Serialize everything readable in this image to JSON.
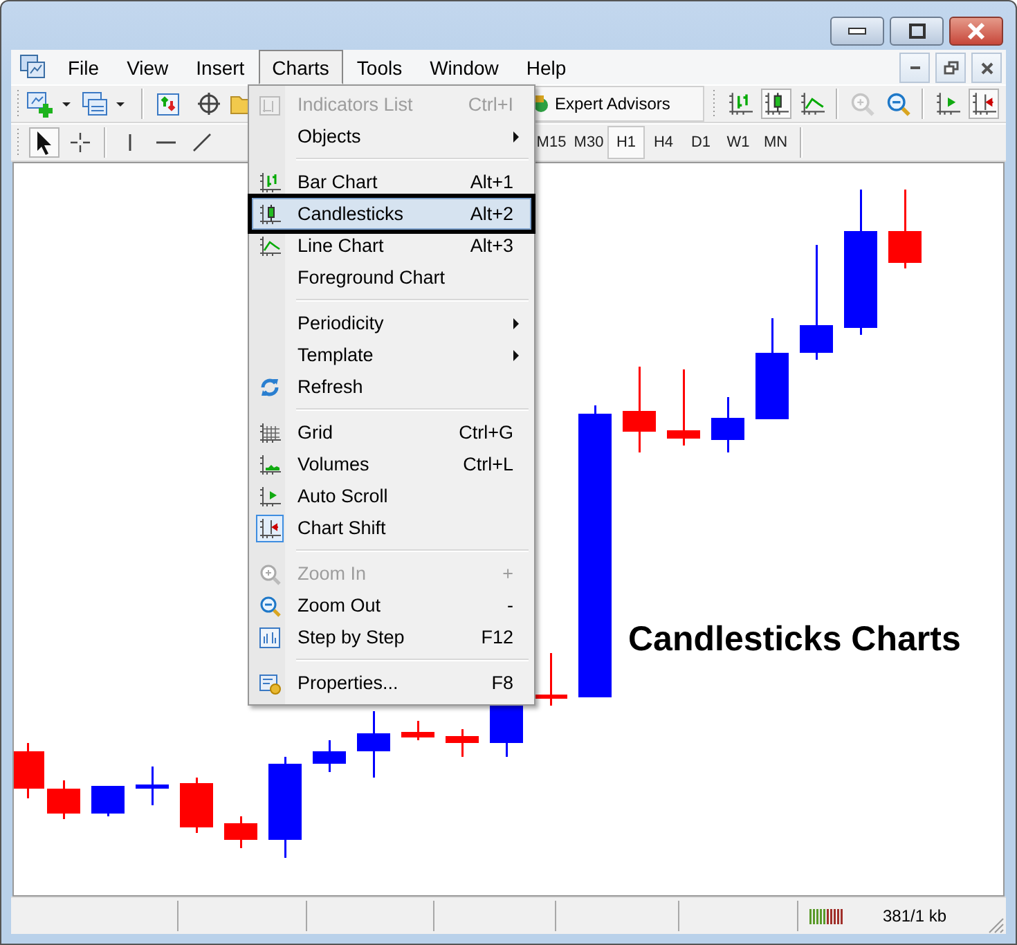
{
  "menu_bar": {
    "items": [
      {
        "label": "File",
        "selected": false
      },
      {
        "label": "View",
        "selected": false
      },
      {
        "label": "Insert",
        "selected": false
      },
      {
        "label": "Charts",
        "selected": true
      },
      {
        "label": "Tools",
        "selected": false
      },
      {
        "label": "Window",
        "selected": false
      },
      {
        "label": "Help",
        "selected": false
      }
    ]
  },
  "toolbar": {
    "expert_advisors": "Expert Advisors",
    "chart_type_buttons": [
      {
        "selected": false
      },
      {
        "selected": true
      },
      {
        "selected": false
      }
    ],
    "zoom_in_disabled": true,
    "chart_shift_on": true
  },
  "drawing_toolbar": {
    "tools": [
      {
        "selected": true
      },
      {
        "selected": false
      }
    ],
    "timeframes": [
      {
        "label": "M15",
        "selected": false
      },
      {
        "label": "M30",
        "selected": false
      },
      {
        "label": "H1",
        "selected": true
      },
      {
        "label": "H4",
        "selected": false
      },
      {
        "label": "D1",
        "selected": false
      },
      {
        "label": "W1",
        "selected": false
      },
      {
        "label": "MN",
        "selected": false
      }
    ]
  },
  "charts_menu": {
    "items": [
      {
        "kind": "item",
        "label": "Indicators List",
        "shortcut": "Ctrl+I",
        "disabled": true,
        "selected": false,
        "checked": false,
        "submenu": false
      },
      {
        "kind": "item",
        "label": "Objects",
        "disabled": false,
        "selected": false,
        "checked": false,
        "submenu": true
      },
      {
        "kind": "separator"
      },
      {
        "kind": "item",
        "label": "Bar Chart",
        "shortcut": "Alt+1",
        "disabled": false,
        "selected": false,
        "checked": false,
        "submenu": false
      },
      {
        "kind": "item",
        "label": "Candlesticks",
        "shortcut": "Alt+2",
        "disabled": false,
        "selected": true,
        "checked": false,
        "submenu": false
      },
      {
        "kind": "item",
        "label": "Line Chart",
        "shortcut": "Alt+3",
        "disabled": false,
        "selected": false,
        "checked": false,
        "submenu": false
      },
      {
        "kind": "item",
        "label": "Foreground Chart",
        "disabled": false,
        "selected": false,
        "checked": false,
        "submenu": false
      },
      {
        "kind": "separator"
      },
      {
        "kind": "item",
        "label": "Periodicity",
        "disabled": false,
        "selected": false,
        "checked": false,
        "submenu": true
      },
      {
        "kind": "item",
        "label": "Template",
        "disabled": false,
        "selected": false,
        "checked": false,
        "submenu": true
      },
      {
        "kind": "item",
        "label": "Refresh",
        "disabled": false,
        "selected": false,
        "checked": false,
        "submenu": false
      },
      {
        "kind": "separator"
      },
      {
        "kind": "item",
        "label": "Grid",
        "shortcut": "Ctrl+G",
        "disabled": false,
        "selected": false,
        "checked": false,
        "submenu": false
      },
      {
        "kind": "item",
        "label": "Volumes",
        "shortcut": "Ctrl+L",
        "disabled": false,
        "selected": false,
        "checked": false,
        "submenu": false
      },
      {
        "kind": "item",
        "label": "Auto Scroll",
        "disabled": false,
        "selected": false,
        "checked": false,
        "submenu": false
      },
      {
        "kind": "item",
        "label": "Chart Shift",
        "disabled": false,
        "selected": false,
        "checked": true,
        "submenu": false
      },
      {
        "kind": "separator"
      },
      {
        "kind": "item",
        "label": "Zoom In",
        "shortcut": "+",
        "disabled": true,
        "selected": false,
        "checked": false,
        "submenu": false
      },
      {
        "kind": "item",
        "label": "Zoom Out",
        "shortcut": "-",
        "disabled": false,
        "selected": false,
        "checked": false,
        "submenu": false
      },
      {
        "kind": "item",
        "label": "Step by Step",
        "shortcut": "F12",
        "disabled": false,
        "selected": false,
        "checked": false,
        "submenu": false
      },
      {
        "kind": "separator"
      },
      {
        "kind": "item",
        "label": "Properties...",
        "shortcut": "F8",
        "disabled": false,
        "selected": false,
        "checked": false,
        "submenu": false
      }
    ]
  },
  "chart": {
    "caption": "Candlesticks Charts"
  },
  "status_bar": {
    "traffic": "381/1 kb"
  }
}
